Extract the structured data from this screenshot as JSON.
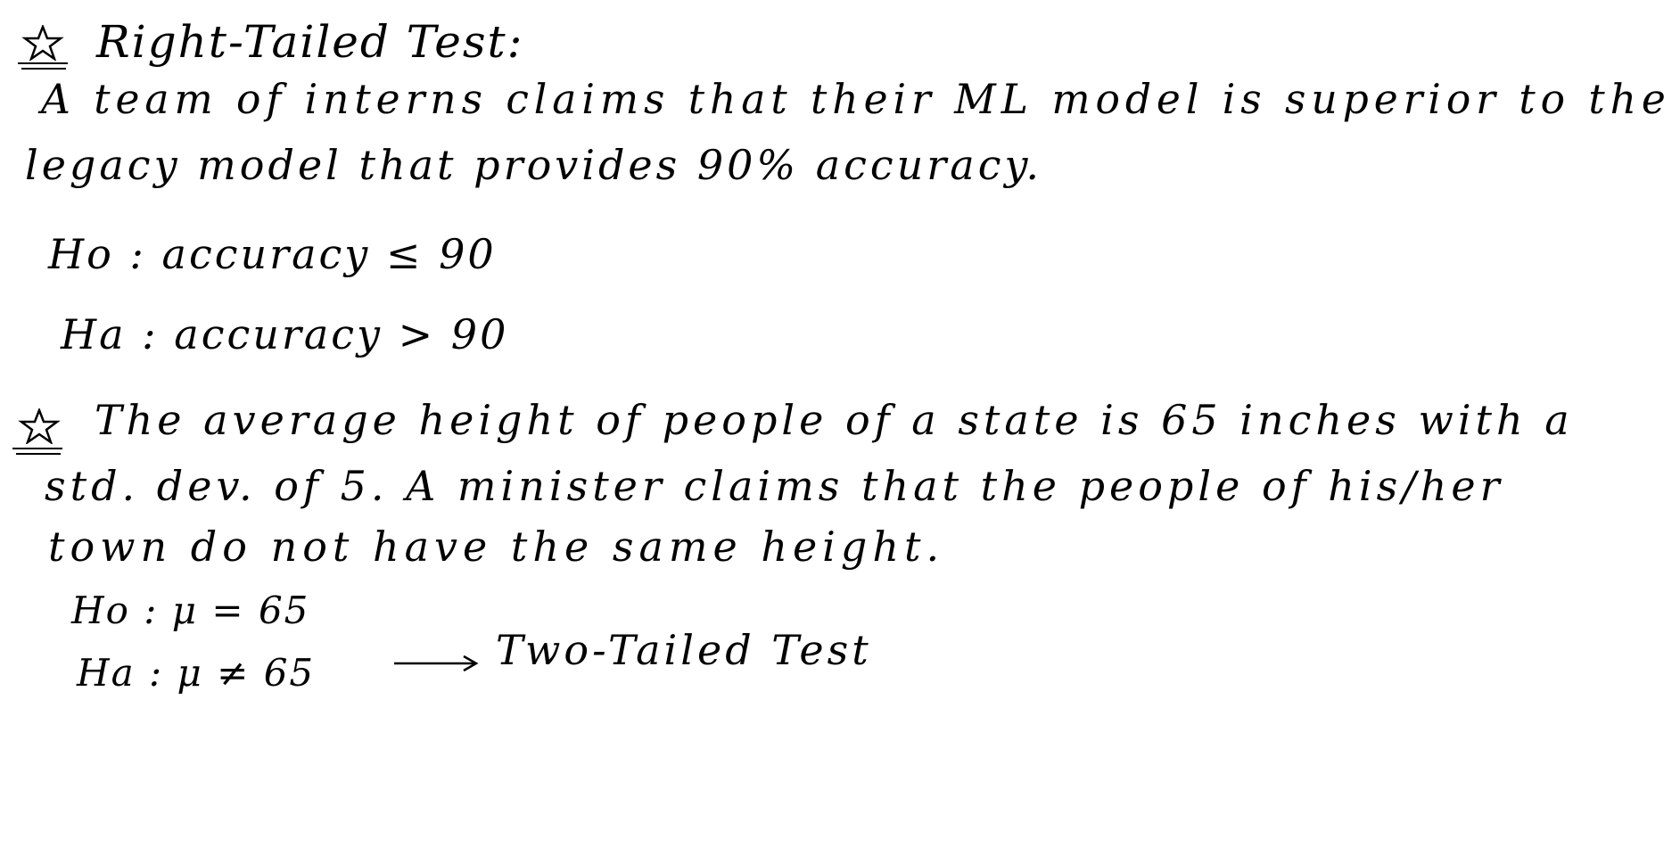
{
  "section1": {
    "heading": "Right-Tailed Test:",
    "line1": "A team of interns claims that their ML model is superior to the",
    "line2": "legacy model that provides 90% accuracy.",
    "h0": "Ho : accuracy ≤ 90",
    "ha": "Ha : accuracy > 90"
  },
  "section2": {
    "line1": "The average height of people of a state is 65 inches with a",
    "line2": "std. dev. of 5. A minister claims that the people of his/her",
    "line3": "town do not have the same height.",
    "h0": "Ho : μ = 65",
    "ha": "Ha : μ ≠ 65",
    "label": "Two-Tailed Test"
  }
}
